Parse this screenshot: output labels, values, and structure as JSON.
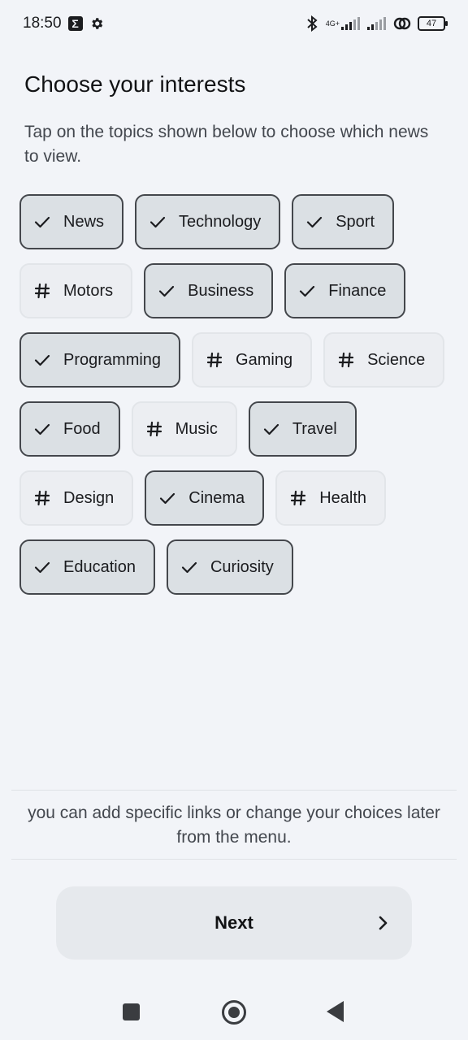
{
  "status_bar": {
    "time": "18:50",
    "network": "4G+",
    "battery": "47"
  },
  "header": {
    "title": "Choose your interests",
    "subtitle": "Tap on the topics shown below to choose which news to view."
  },
  "topics": [
    {
      "label": "News",
      "selected": true
    },
    {
      "label": "Technology",
      "selected": true
    },
    {
      "label": "Sport",
      "selected": true
    },
    {
      "label": "Motors",
      "selected": false
    },
    {
      "label": "Business",
      "selected": true
    },
    {
      "label": "Finance",
      "selected": true
    },
    {
      "label": "Programming",
      "selected": true
    },
    {
      "label": "Gaming",
      "selected": false
    },
    {
      "label": "Science",
      "selected": false
    },
    {
      "label": "Food",
      "selected": true
    },
    {
      "label": "Music",
      "selected": false
    },
    {
      "label": "Travel",
      "selected": true
    },
    {
      "label": "Design",
      "selected": false
    },
    {
      "label": "Cinema",
      "selected": true
    },
    {
      "label": "Health",
      "selected": false
    },
    {
      "label": "Education",
      "selected": true
    },
    {
      "label": "Curiosity",
      "selected": true
    }
  ],
  "footer": {
    "note": "you can add specific links or change your choices later from the menu.",
    "next_label": "Next"
  },
  "icons": {
    "selected": "check-icon",
    "unselected": "hashtag-icon"
  }
}
